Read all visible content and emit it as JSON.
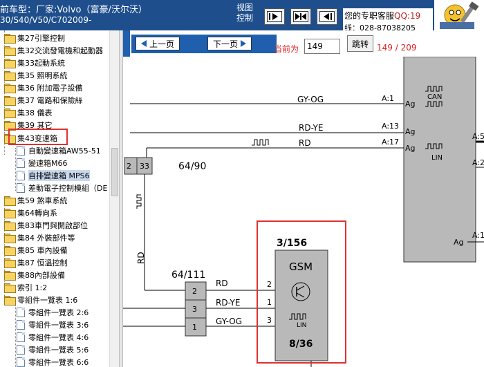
{
  "header": {
    "model_line1": "前车型：厂家:Volvo（富豪/沃尔沃）",
    "model_line2": "30/S40/V50/C702009-",
    "control_label": "视图控制",
    "customer_service": "您的专职客服",
    "qq_label": "QQ:19",
    "phone": "线：028-87038205"
  },
  "tree": {
    "items": [
      {
        "label": "集27引擎控制",
        "type": "folder"
      },
      {
        "label": "集32交流發電機和起動器",
        "type": "folder"
      },
      {
        "label": "集33起動系統",
        "type": "folder"
      },
      {
        "label": "集35 照明系統",
        "type": "folder"
      },
      {
        "label": "集36 附加電子設備",
        "type": "folder"
      },
      {
        "label": "集37 電路和保險絲",
        "type": "folder"
      },
      {
        "label": "集38 儀表",
        "type": "folder"
      },
      {
        "label": "集39 其它",
        "type": "folder"
      },
      {
        "label": "集43变速箱",
        "type": "folder"
      },
      {
        "label": "自動變速箱AW55-51",
        "type": "doc"
      },
      {
        "label": "變速箱M66",
        "type": "doc"
      },
      {
        "label": "自排變速箱 MPS6",
        "type": "doc"
      },
      {
        "label": "差動電子控制模組（DE",
        "type": "doc"
      },
      {
        "label": "集59 煞車系統",
        "type": "folder"
      },
      {
        "label": "集64轉向系",
        "type": "folder"
      },
      {
        "label": "集83車門與開啟部位",
        "type": "folder"
      },
      {
        "label": "集84 外裝部件等",
        "type": "folder"
      },
      {
        "label": "集85 車內設備",
        "type": "folder"
      },
      {
        "label": "集87 恒溫控制",
        "type": "folder"
      },
      {
        "label": "集88內部設備",
        "type": "folder"
      },
      {
        "label": "索引 1:2",
        "type": "folder"
      },
      {
        "label": "零組件一覽表 1:6",
        "type": "folder"
      },
      {
        "label": "零組件一覽表 2:6",
        "type": "doc"
      },
      {
        "label": "零組件一覽表 3:6",
        "type": "doc"
      },
      {
        "label": "零組件一覽表 4:6",
        "type": "doc"
      },
      {
        "label": "零組件一覽表 5:6",
        "type": "doc"
      },
      {
        "label": "零組件一覽表 6:6",
        "type": "doc"
      }
    ]
  },
  "toolbar": {
    "prev_label": "上一页",
    "next_label": "下一页",
    "current_label": "当前为",
    "page_value": "149",
    "jump_label": "跳转",
    "page_count": "149 / 209"
  },
  "diagram": {
    "can_module": {
      "pins": [
        {
          "pin": "A:1",
          "code": "Ag",
          "wire": "GY-OG"
        },
        {
          "pin": "A:13",
          "code": "Ag",
          "wire": "RD-YE"
        },
        {
          "pin": "A:17",
          "code": "Ag",
          "wire": "RD"
        }
      ],
      "can_label": "CAN",
      "lin_label": "LIN",
      "lower_pin": "A:1",
      "lower_code": "Ag"
    },
    "right_pins": [
      "A:5",
      "A:2"
    ],
    "connector_top": {
      "pins": [
        "2",
        "33"
      ],
      "id": "64/90"
    },
    "vertical_wire": "RD",
    "connector_mid": {
      "id": "64/111",
      "pins": [
        "2",
        "3",
        "1"
      ]
    },
    "gsm": {
      "top_id": "3/156",
      "name": "GSM",
      "lin_label": "LIN",
      "bottom_id": "8/36",
      "wires": [
        {
          "wire": "RD",
          "pin": "2"
        },
        {
          "wire": "RD-YE",
          "pin": "1"
        },
        {
          "wire": "GY-OG",
          "pin": "3"
        }
      ]
    },
    "colors": {
      "highlight": "#e03030",
      "module_fill": "#b9b9b9",
      "toolbar_blue": "#1f5fae"
    }
  }
}
